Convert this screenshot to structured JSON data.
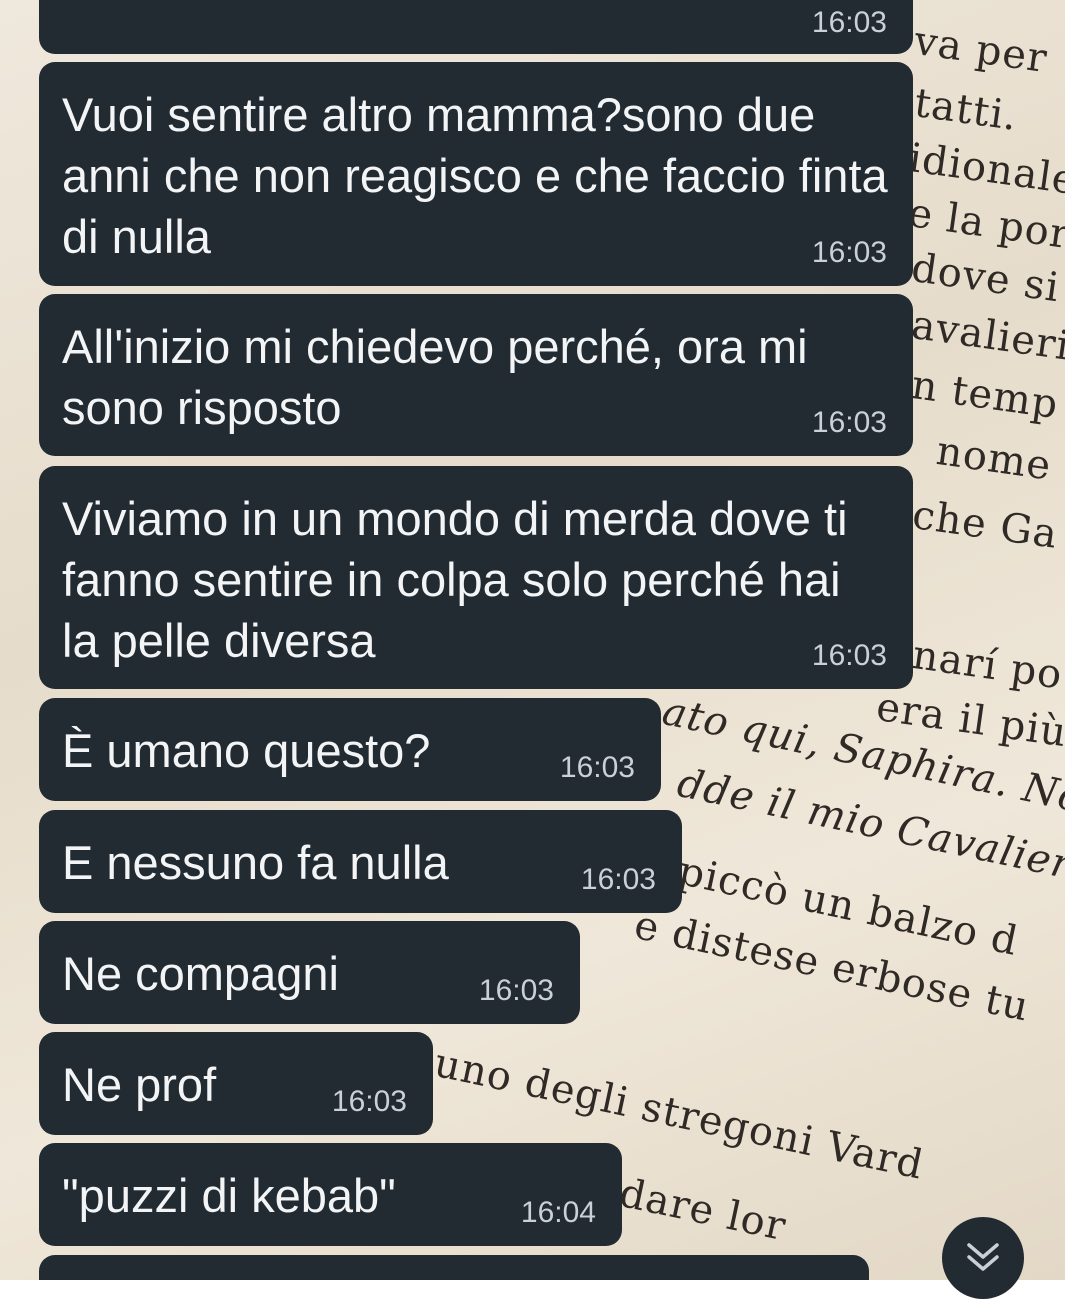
{
  "wallpaper": {
    "lines": [
      "va per",
      "tatti.",
      "idionale",
      "e la por",
      "dove si",
      "avalieri",
      "n temp",
      "nome",
      "che Ga",
      "narí po",
      "era il più",
      "ato qui, Saphira. No",
      "dde il mio Cavaliere.",
      "piccò un balzo d",
      "e distese erbose tu",
      "uno degli stregoni Vard",
      "dare lor"
    ]
  },
  "messages": [
    {
      "text": "",
      "time": "16:03"
    },
    {
      "text": "Vuoi sentire altro mamma?sono due anni che non reagisco e che faccio finta di nulla",
      "time": "16:03"
    },
    {
      "text": "All'inizio mi chiedevo perché, ora mi sono risposto",
      "time": "16:03"
    },
    {
      "text": "Viviamo in un mondo di merda dove ti fanno sentire in colpa solo perché hai la pelle diversa",
      "time": "16:03"
    },
    {
      "text": "È umano questo?",
      "time": "16:03"
    },
    {
      "text": "E nessuno fa nulla",
      "time": "16:03"
    },
    {
      "text": "Ne compagni",
      "time": "16:03"
    },
    {
      "text": "Ne prof",
      "time": "16:03"
    },
    {
      "text": "\"puzzi di kebab\"",
      "time": "16:04"
    },
    {
      "text": "",
      "time": ""
    }
  ],
  "scroll_button": {
    "icon": "chevrons-down-icon"
  },
  "colors": {
    "bubble": "#222a32",
    "bubble_text": "#f2f4f5",
    "time_text": "#c9d0d6"
  }
}
